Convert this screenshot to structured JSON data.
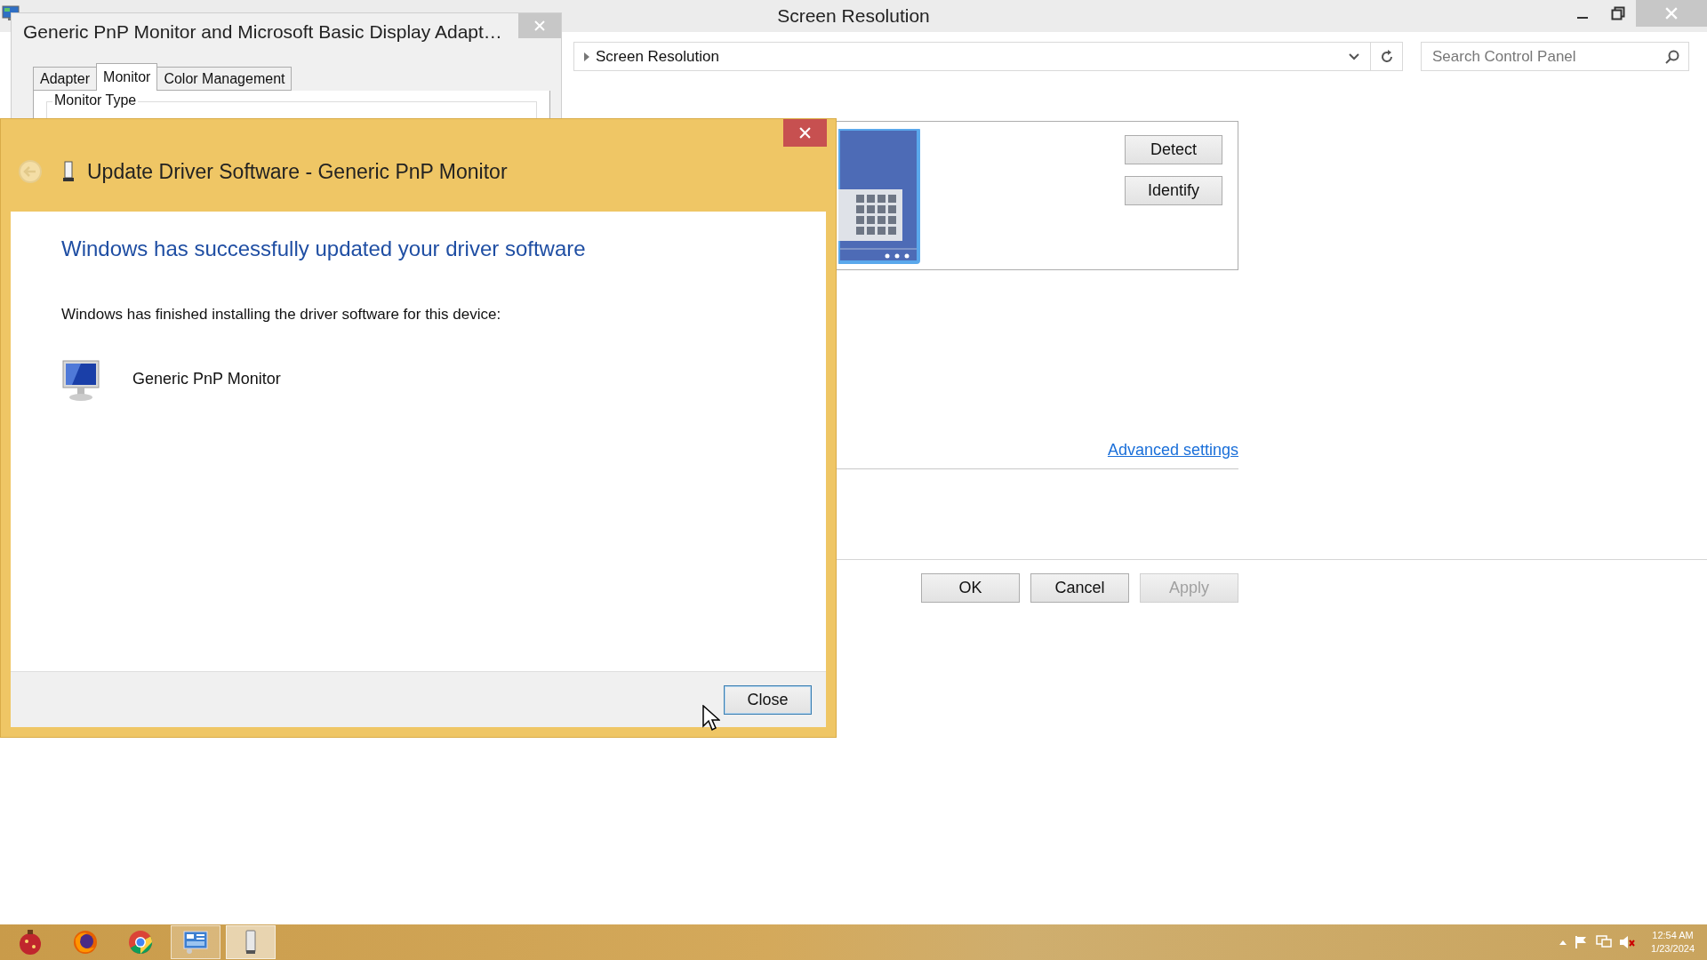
{
  "main_window": {
    "title": "Screen Resolution",
    "breadcrumb": "Screen Resolution",
    "search": {
      "placeholder": "Search Control Panel"
    },
    "display_buttons": [
      {
        "label": "Detect"
      },
      {
        "label": "Identify"
      }
    ],
    "advanced_link": "Advanced settings",
    "footer_buttons": [
      {
        "label": "OK",
        "disabled": false
      },
      {
        "label": "Cancel",
        "disabled": false
      },
      {
        "label": "Apply",
        "disabled": true
      }
    ]
  },
  "properties_window": {
    "title": "Generic PnP Monitor and Microsoft Basic Display Adapt…",
    "tabs": [
      {
        "label": "Adapter",
        "selected": false
      },
      {
        "label": "Monitor",
        "selected": true
      },
      {
        "label": "Color Management",
        "selected": false
      }
    ],
    "group_label": "Monitor Type"
  },
  "dialog": {
    "title": "Update Driver Software - Generic PnP Monitor",
    "heading": "Windows has successfully updated your driver software",
    "message": "Windows has finished installing the driver software for this device:",
    "device": "Generic PnP Monitor",
    "button": "Close"
  },
  "taskbar": {
    "apps": [
      {
        "kind": "ornament",
        "running": false,
        "selected": false
      },
      {
        "kind": "firefox",
        "running": false,
        "selected": false
      },
      {
        "kind": "chrome",
        "running": false,
        "selected": false
      },
      {
        "kind": "control-panel",
        "running": true,
        "selected": false
      },
      {
        "kind": "device",
        "running": true,
        "selected": true
      }
    ],
    "time": "12:54 AM",
    "date": "1/23/2024"
  }
}
